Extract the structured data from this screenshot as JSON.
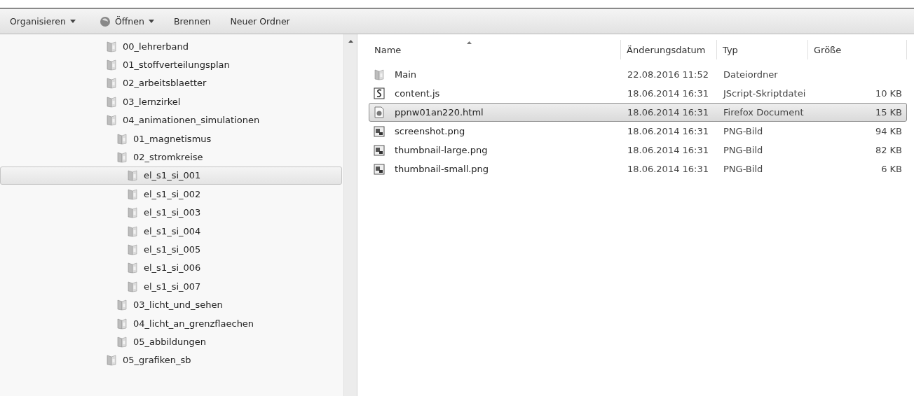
{
  "toolbar": {
    "items": [
      {
        "label": "Organisieren",
        "dropdown": true,
        "icon": false
      },
      {
        "label": "Öffnen",
        "dropdown": true,
        "icon": true
      },
      {
        "label": "Brennen",
        "dropdown": false,
        "icon": false
      },
      {
        "label": "Neuer Ordner",
        "dropdown": false,
        "icon": false
      }
    ]
  },
  "tree": {
    "items": [
      {
        "label": "00_lehrerband",
        "selected": false
      },
      {
        "label": "01_stoffverteilungsplan",
        "selected": false
      },
      {
        "label": "02_arbeitsblaetter",
        "selected": false
      },
      {
        "label": "03_lernzirkel",
        "selected": false
      },
      {
        "label": "04_animationen_simulationen",
        "selected": false,
        "children": [
          {
            "label": "01_magnetismus",
            "selected": false
          },
          {
            "label": "02_stromkreise",
            "selected": false,
            "children": [
              {
                "label": "el_s1_si_001",
                "selected": true
              },
              {
                "label": "el_s1_si_002",
                "selected": false
              },
              {
                "label": "el_s1_si_003",
                "selected": false
              },
              {
                "label": "el_s1_si_004",
                "selected": false
              },
              {
                "label": "el_s1_si_005",
                "selected": false
              },
              {
                "label": "el_s1_si_006",
                "selected": false
              },
              {
                "label": "el_s1_si_007",
                "selected": false
              }
            ]
          },
          {
            "label": "03_licht_und_sehen",
            "selected": false
          },
          {
            "label": "04_licht_an_grenzflaechen",
            "selected": false
          },
          {
            "label": "05_abbildungen",
            "selected": false
          }
        ]
      },
      {
        "label": "05_grafiken_sb",
        "selected": false
      }
    ]
  },
  "files": {
    "columns": [
      "Name",
      "Änderungsdatum",
      "Typ",
      "Größe"
    ],
    "rows": [
      {
        "kind": "folder",
        "name": "Main",
        "date": "22.08.2016 11:52",
        "type": "Dateiordner",
        "selected": false
      },
      {
        "kind": "script",
        "name": "content.js",
        "date": "18.06.2014 16:31",
        "type": "JScript-Skriptdatei",
        "size": "10 KB",
        "selected": false
      },
      {
        "kind": "document",
        "name": "ppnw01an220.html",
        "date": "18.06.2014 16:31",
        "type": "Firefox Document",
        "size": "15 KB",
        "selected": true
      },
      {
        "kind": "image",
        "name": "screenshot.png",
        "date": "18.06.2014 16:31",
        "type": "PNG-Bild",
        "size": "94 KB",
        "selected": false
      },
      {
        "kind": "image",
        "name": "thumbnail-large.png",
        "date": "18.06.2014 16:31",
        "type": "PNG-Bild",
        "size": "82 KB",
        "selected": false
      },
      {
        "kind": "image",
        "name": "thumbnail-small.png",
        "date": "18.06.2014 16:31",
        "type": "PNG-Bild",
        "size": "6 KB",
        "selected": false
      }
    ]
  }
}
